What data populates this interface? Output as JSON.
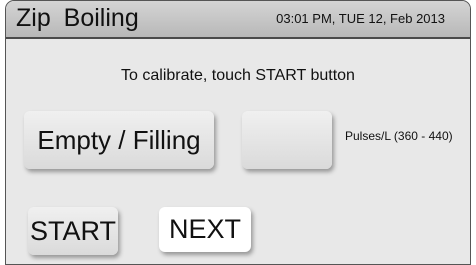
{
  "header": {
    "title": "Zip Boiling",
    "datetime": "03:01 PM, TUE 12, Feb 2013"
  },
  "main": {
    "instruction": "To calibrate, touch  START button",
    "mode_button_label": "Empty / Filling",
    "value_display": "",
    "pulses_label": "Pulses/L (360 - 440)"
  },
  "footer": {
    "start_label": "START",
    "next_label": "NEXT"
  }
}
